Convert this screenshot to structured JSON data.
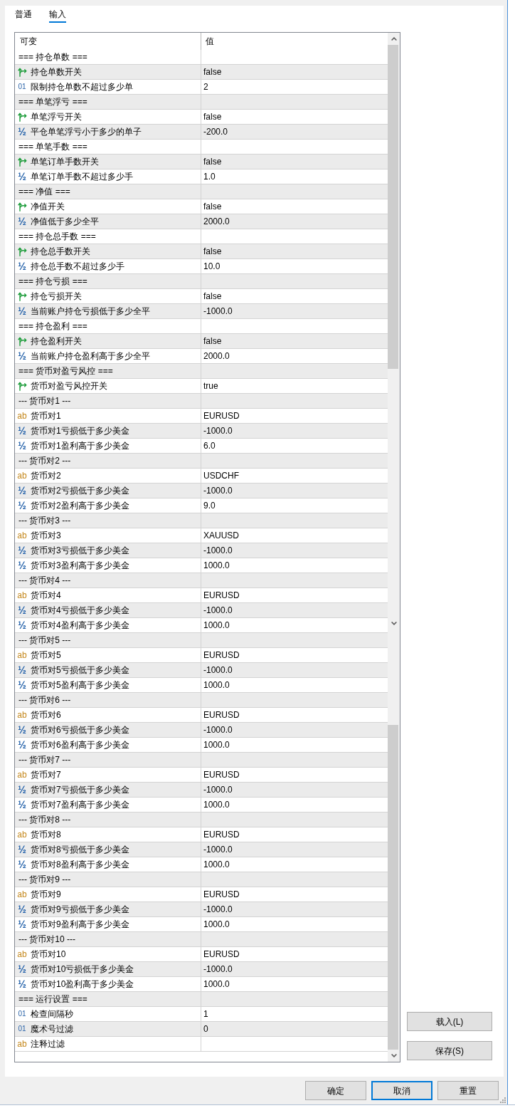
{
  "tabs": [
    {
      "label": "普通",
      "selected": false
    },
    {
      "label": "输入",
      "selected": true
    }
  ],
  "table": {
    "columns": [
      "可变",
      "值"
    ],
    "rows": [
      {
        "kind": "section",
        "name": "=== 持仓单数 ==="
      },
      {
        "kind": "bool",
        "name": "持仓单数开关",
        "value": "false"
      },
      {
        "kind": "int",
        "icon": "01",
        "name": "限制持仓单数不超过多少单",
        "value": "2"
      },
      {
        "kind": "section",
        "name": "=== 单笔浮亏 ==="
      },
      {
        "kind": "bool",
        "name": "单笔浮亏开关",
        "value": "false"
      },
      {
        "kind": "double",
        "icon": "½",
        "name": "平仓单笔浮亏小于多少的单子",
        "value": "-200.0"
      },
      {
        "kind": "section",
        "name": "=== 单笔手数 ==="
      },
      {
        "kind": "bool",
        "name": "单笔订单手数开关",
        "value": "false"
      },
      {
        "kind": "double",
        "icon": "½",
        "name": "单笔订单手数不超过多少手",
        "value": "1.0"
      },
      {
        "kind": "section",
        "name": "=== 净值 ==="
      },
      {
        "kind": "bool",
        "name": "净值开关",
        "value": "false"
      },
      {
        "kind": "double",
        "icon": "½",
        "name": "净值低于多少全平",
        "value": "2000.0"
      },
      {
        "kind": "section",
        "name": "=== 持仓总手数 ==="
      },
      {
        "kind": "bool",
        "name": "持仓总手数开关",
        "value": "false"
      },
      {
        "kind": "double",
        "icon": "½",
        "name": "持仓总手数不超过多少手",
        "value": "10.0"
      },
      {
        "kind": "section",
        "name": "=== 持仓亏损 ==="
      },
      {
        "kind": "bool",
        "name": "持仓亏损开关",
        "value": "false"
      },
      {
        "kind": "double",
        "icon": "½",
        "name": "当前账户持仓亏损低于多少全平",
        "value": "-1000.0"
      },
      {
        "kind": "section",
        "name": "=== 持仓盈利 ==="
      },
      {
        "kind": "bool",
        "name": "持仓盈利开关",
        "value": "false"
      },
      {
        "kind": "double",
        "icon": "½",
        "name": "当前账户持仓盈利高于多少全平",
        "value": "2000.0"
      },
      {
        "kind": "section",
        "name": "=== 货币对盈亏风控 ==="
      },
      {
        "kind": "bool",
        "name": "货币对盈亏风控开关",
        "value": "true"
      },
      {
        "kind": "section",
        "name": "--- 货币对1 ---"
      },
      {
        "kind": "string",
        "icon": "ab",
        "name": "货币对1",
        "value": "EURUSD"
      },
      {
        "kind": "double",
        "icon": "½",
        "name": "货币对1亏损低于多少美金",
        "value": "-1000.0"
      },
      {
        "kind": "double",
        "icon": "½",
        "name": "货币对1盈利高于多少美金",
        "value": "6.0"
      },
      {
        "kind": "section",
        "name": "--- 货币对2 ---"
      },
      {
        "kind": "string",
        "icon": "ab",
        "name": "货币对2",
        "value": "USDCHF"
      },
      {
        "kind": "double",
        "icon": "½",
        "name": "货币对2亏损低于多少美金",
        "value": "-1000.0"
      },
      {
        "kind": "double",
        "icon": "½",
        "name": "货币对2盈利高于多少美金",
        "value": "9.0"
      },
      {
        "kind": "section",
        "name": "--- 货币对3 ---"
      },
      {
        "kind": "string",
        "icon": "ab",
        "name": "货币对3",
        "value": "XAUUSD"
      },
      {
        "kind": "double",
        "icon": "½",
        "name": "货币对3亏损低于多少美金",
        "value": "-1000.0"
      },
      {
        "kind": "double",
        "icon": "½",
        "name": "货币对3盈利高于多少美金",
        "value": "1000.0"
      },
      {
        "kind": "section",
        "name": "--- 货币对4 ---"
      },
      {
        "kind": "string",
        "icon": "ab",
        "name": "货币对4",
        "value": "EURUSD"
      },
      {
        "kind": "double",
        "icon": "½",
        "name": "货币对4亏损低于多少美金",
        "value": "-1000.0"
      },
      {
        "kind": "double",
        "icon": "½",
        "name": "货币对4盈利高于多少美金",
        "value": "1000.0"
      },
      {
        "kind": "section",
        "name": "--- 货币对5 ---"
      },
      {
        "kind": "string",
        "icon": "ab",
        "name": "货币对5",
        "value": "EURUSD"
      },
      {
        "kind": "double",
        "icon": "½",
        "name": "货币对5亏损低于多少美金",
        "value": "-1000.0"
      },
      {
        "kind": "double",
        "icon": "½",
        "name": "货币对5盈利高于多少美金",
        "value": "1000.0"
      },
      {
        "kind": "section",
        "name": "--- 货币对6 ---"
      },
      {
        "kind": "string",
        "icon": "ab",
        "name": "货币对6",
        "value": "EURUSD"
      },
      {
        "kind": "double",
        "icon": "½",
        "name": "货币对6亏损低于多少美金",
        "value": "-1000.0"
      },
      {
        "kind": "double",
        "icon": "½",
        "name": "货币对6盈利高于多少美金",
        "value": "1000.0"
      },
      {
        "kind": "section",
        "name": "--- 货币对7 ---"
      },
      {
        "kind": "string",
        "icon": "ab",
        "name": "货币对7",
        "value": "EURUSD"
      },
      {
        "kind": "double",
        "icon": "½",
        "name": "货币对7亏损低于多少美金",
        "value": "-1000.0"
      },
      {
        "kind": "double",
        "icon": "½",
        "name": "货币对7盈利高于多少美金",
        "value": "1000.0"
      },
      {
        "kind": "section",
        "name": "--- 货币对8 ---"
      },
      {
        "kind": "string",
        "icon": "ab",
        "name": "货币对8",
        "value": "EURUSD"
      },
      {
        "kind": "double",
        "icon": "½",
        "name": "货币对8亏损低于多少美金",
        "value": "-1000.0"
      },
      {
        "kind": "double",
        "icon": "½",
        "name": "货币对8盈利高于多少美金",
        "value": "1000.0"
      },
      {
        "kind": "section",
        "name": "--- 货币对9 ---"
      },
      {
        "kind": "string",
        "icon": "ab",
        "name": "货币对9",
        "value": "EURUSD"
      },
      {
        "kind": "double",
        "icon": "½",
        "name": "货币对9亏损低于多少美金",
        "value": "-1000.0"
      },
      {
        "kind": "double",
        "icon": "½",
        "name": "货币对9盈利高于多少美金",
        "value": "1000.0"
      },
      {
        "kind": "section",
        "name": "--- 货币对10 ---"
      },
      {
        "kind": "string",
        "icon": "ab",
        "name": "货币对10",
        "value": "EURUSD"
      },
      {
        "kind": "double",
        "icon": "½",
        "name": "货币对10亏损低于多少美金",
        "value": "-1000.0"
      },
      {
        "kind": "double",
        "icon": "½",
        "name": "货币对10盈利高于多少美金",
        "value": "1000.0"
      },
      {
        "kind": "section",
        "name": "=== 运行设置 ==="
      },
      {
        "kind": "int",
        "icon": "01",
        "name": "检查间隔秒",
        "value": "1"
      },
      {
        "kind": "int",
        "icon": "01",
        "name": "魔术号过滤",
        "value": "0"
      },
      {
        "kind": "string",
        "icon": "ab",
        "name": "注释过滤"
      }
    ]
  },
  "side_buttons": [
    "载入(L)",
    "保存(S)"
  ],
  "buttons": [
    {
      "label": "确定",
      "focused": false
    },
    {
      "label": "取消",
      "focused": true
    },
    {
      "label": "重置",
      "focused": false
    }
  ]
}
